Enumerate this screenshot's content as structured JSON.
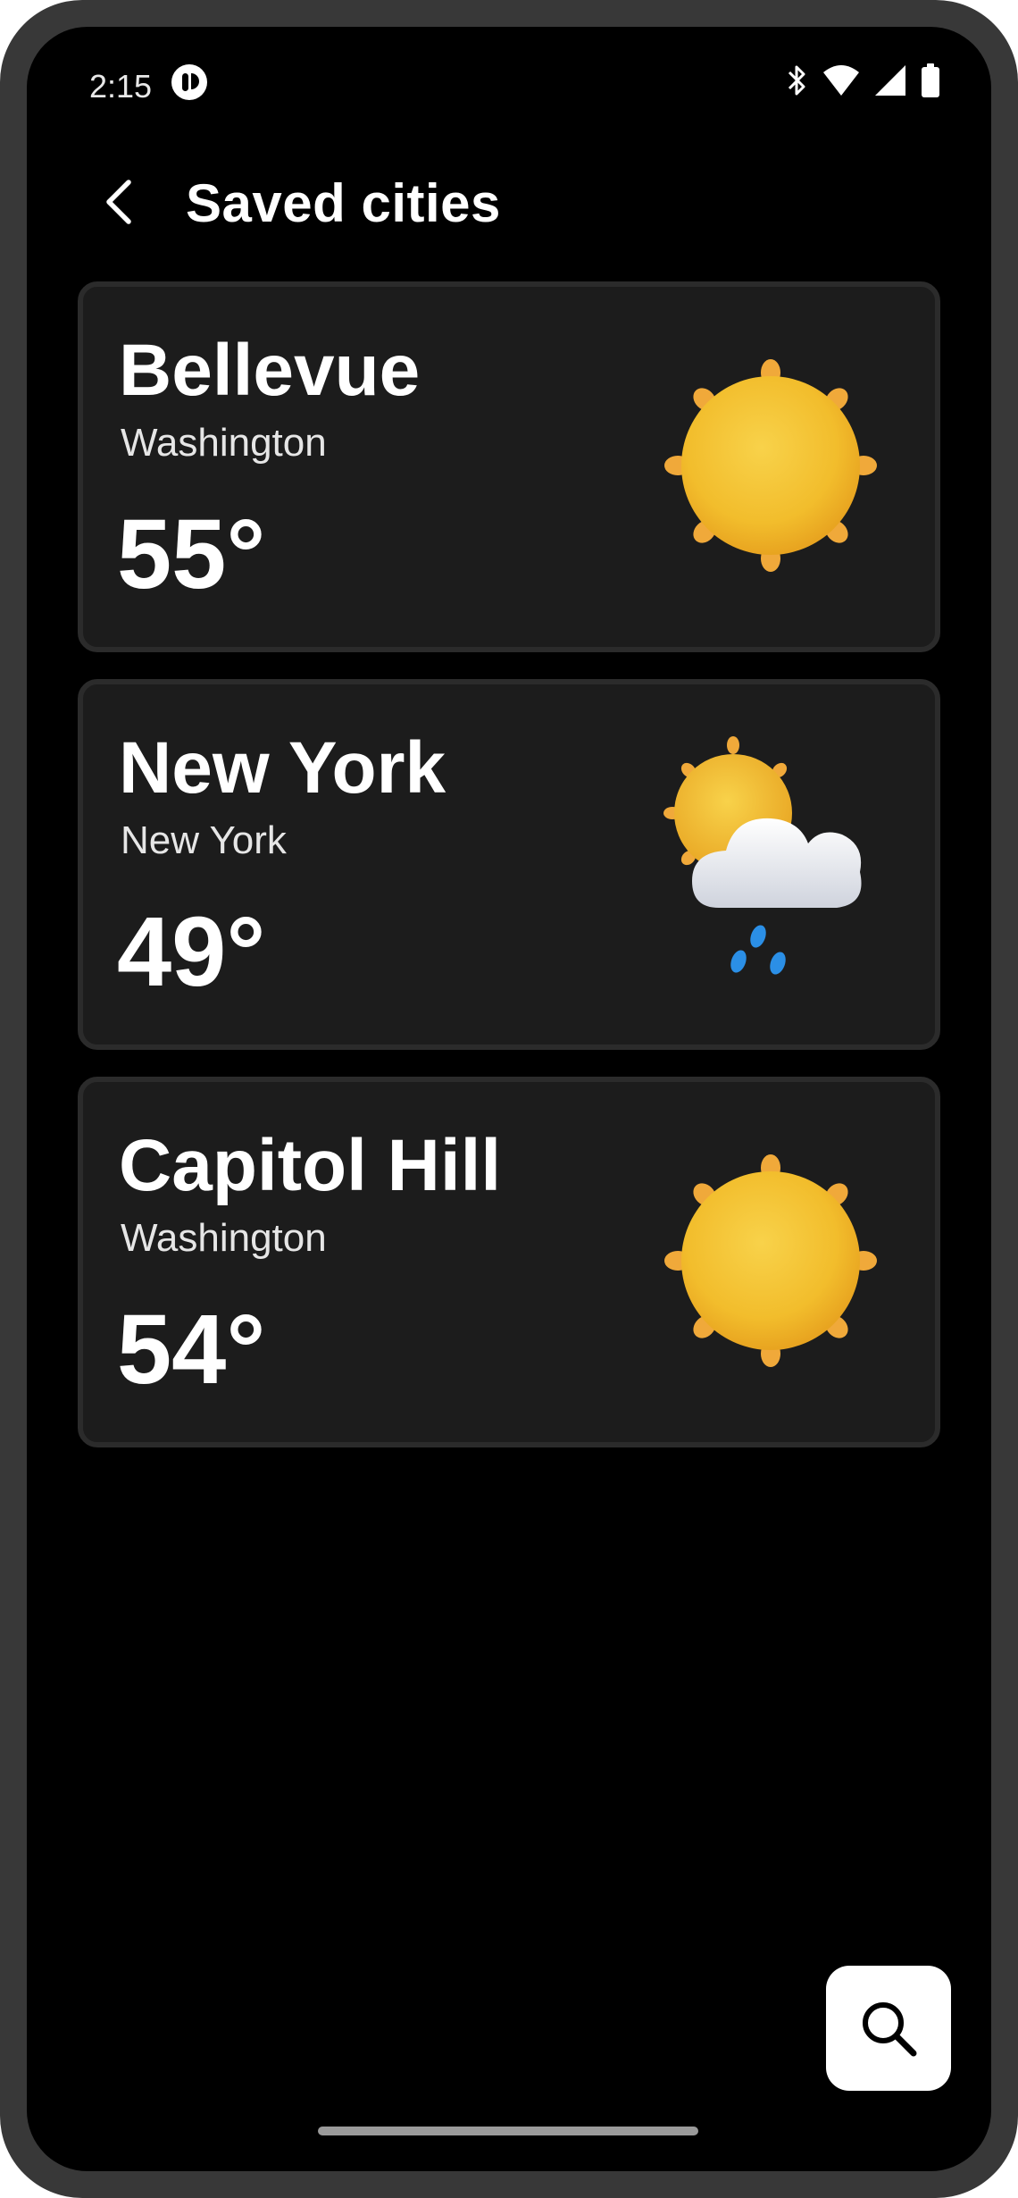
{
  "status_bar": {
    "time": "2:15",
    "icons": [
      "notification-icon",
      "bluetooth-icon",
      "wifi-icon",
      "signal-icon",
      "battery-icon"
    ]
  },
  "header": {
    "back_icon": "back-arrow-icon",
    "title": "Saved cities"
  },
  "cities": [
    {
      "name": "Bellevue",
      "region": "Washington",
      "temperature": "55°",
      "condition_icon": "sunny-icon"
    },
    {
      "name": "New York",
      "region": "New York",
      "temperature": "49°",
      "condition_icon": "partly-cloudy-rain-icon"
    },
    {
      "name": "Capitol Hill",
      "region": "Washington",
      "temperature": "54°",
      "condition_icon": "sunny-icon"
    }
  ],
  "fab": {
    "icon": "search-icon"
  },
  "colors": {
    "background": "#000000",
    "card": "#1c1c1c",
    "card_border": "#2b2b2b",
    "sun": "#f4c430",
    "fab": "#ffffff"
  }
}
